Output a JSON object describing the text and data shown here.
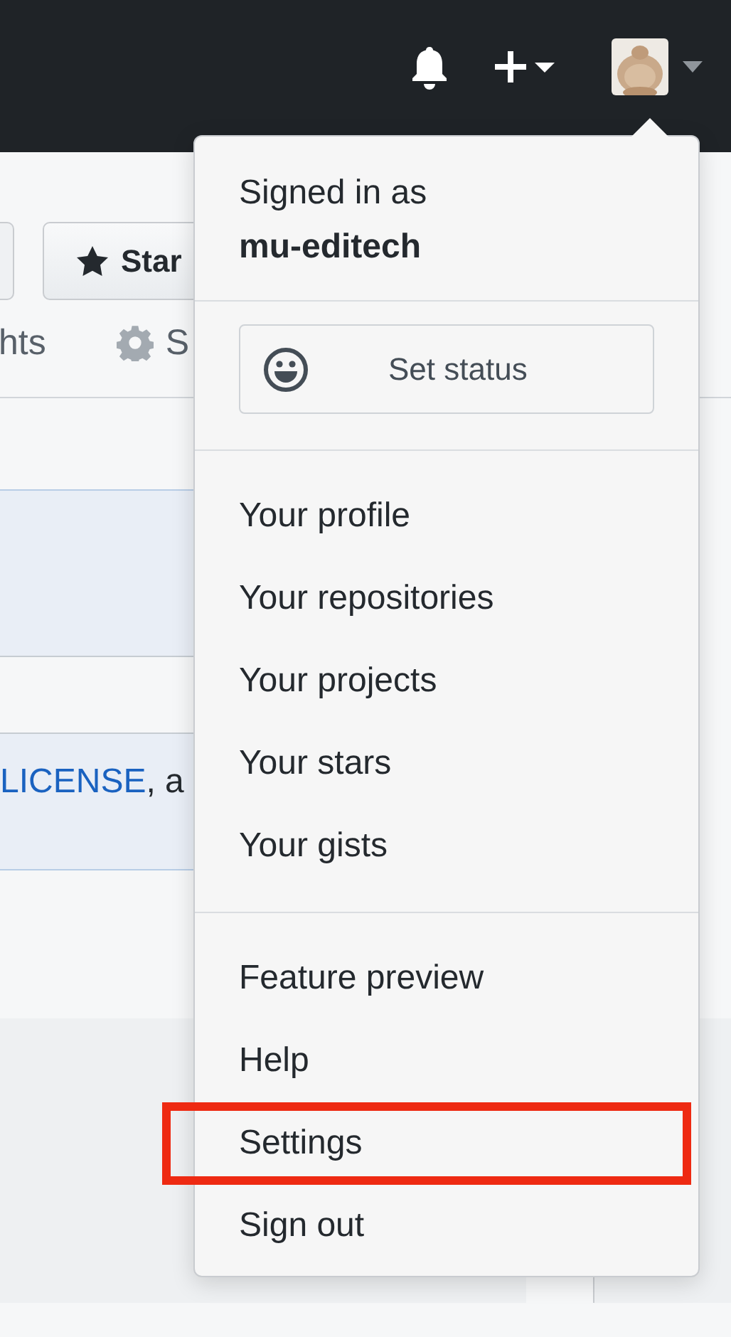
{
  "page": {
    "star_button": "Star",
    "tab_partial": "hts",
    "settings_tab_partial": "S",
    "notice_link": "LICENSE",
    "notice_text": ", a"
  },
  "menu": {
    "signed_in_label": "Signed in as",
    "username": "mu-editech",
    "status_button": "Set status",
    "groups": [
      {
        "items": [
          {
            "label": "Your profile",
            "highlighted": false
          },
          {
            "label": "Your repositories",
            "highlighted": false
          },
          {
            "label": "Your projects",
            "highlighted": false
          },
          {
            "label": "Your stars",
            "highlighted": false
          },
          {
            "label": "Your gists",
            "highlighted": false
          }
        ]
      },
      {
        "items": [
          {
            "label": "Feature preview",
            "highlighted": false
          },
          {
            "label": "Help",
            "highlighted": false
          },
          {
            "label": "Settings",
            "highlighted": true
          },
          {
            "label": "Sign out",
            "highlighted": false
          }
        ]
      }
    ]
  }
}
